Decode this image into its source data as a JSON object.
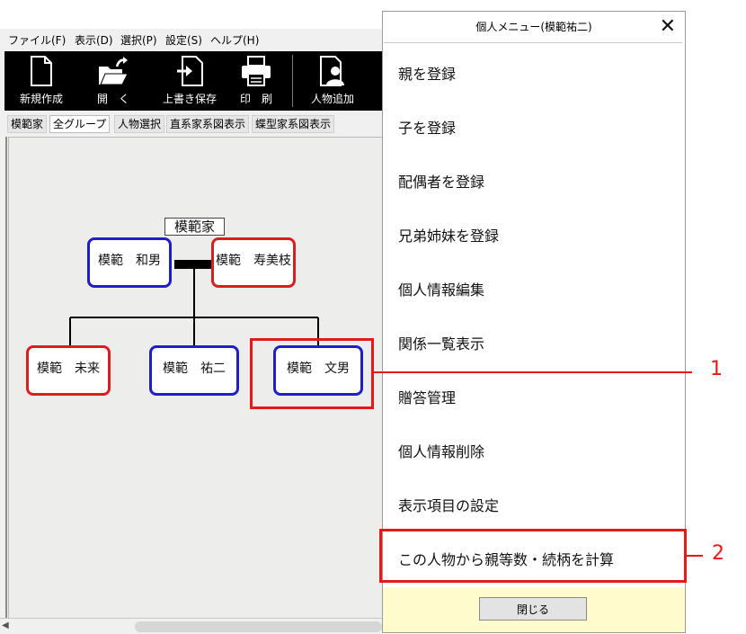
{
  "menubar": {
    "file": "ファイル(F)",
    "view": "表示(D)",
    "select": "選択(P)",
    "settings": "設定(S)",
    "help": "ヘルプ(H)"
  },
  "toolbar": {
    "new": "新規作成",
    "open": "開　く",
    "overwrite": "上書き保存",
    "print": "印　刷",
    "add_person": "人物追加"
  },
  "tabs": [
    "模範家",
    "全グループ",
    "人物選択",
    "直系家系図表示",
    "蝶型家系図表示"
  ],
  "tree": {
    "family_name": "模範家",
    "people": {
      "kazuo": "模範　和男",
      "sumie": "模範　寿美枝",
      "miku": "模範　未来",
      "yuji": "模範　祐二",
      "fumio": "模範　文男"
    }
  },
  "panel": {
    "title": "個人メニュー(模範祐二)",
    "items": [
      "親を登録",
      "子を登録",
      "配偶者を登録",
      "兄弟姉妹を登録",
      "個人情報編集",
      "関係一覧表示",
      "贈答管理",
      "個人情報削除",
      "表示項目の設定",
      "この人物から親等数・続柄を計算"
    ],
    "close": "閉じる"
  },
  "callouts": [
    "1",
    "2"
  ],
  "colors": {
    "male_border": "#1f1fc8",
    "female_border": "#d62020",
    "highlight": "#e61919",
    "footer_bg": "#fffbcd",
    "toolbar_bg": "#000000"
  }
}
